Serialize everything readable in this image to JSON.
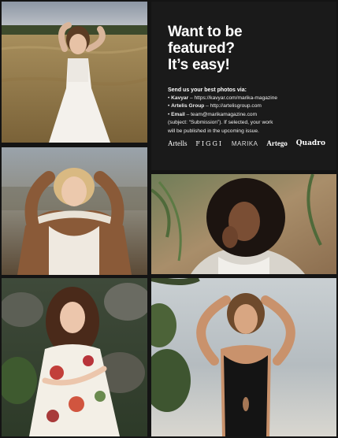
{
  "info": {
    "headline_lines": [
      "Want to be",
      "featured?",
      "It’s easy!"
    ],
    "send_title": "Send us your best photos via:",
    "channels": [
      {
        "name": "Kavyar",
        "sep": " – ",
        "detail": "https://kavyar.com/marika-magazine"
      },
      {
        "name": "Artelis Group",
        "sep": " – ",
        "detail": "http://artelisgroup.com"
      },
      {
        "name": "Email",
        "sep": " – ",
        "detail": "team@marikamagazine.com"
      }
    ],
    "note_line1": "(subject: “Submission”). If selected, your work",
    "note_line2": "will be published in the upcoming issue."
  },
  "logos": [
    "Artells",
    "FIGGI",
    "MARIKA",
    "Artego",
    "Quadro"
  ],
  "colors": {
    "background": "#141414",
    "panel": "#1a1a1a",
    "text": "#ffffff"
  }
}
